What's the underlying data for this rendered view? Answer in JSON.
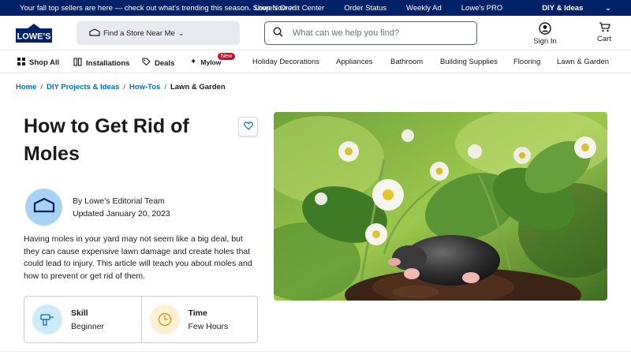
{
  "promo_bar": {
    "promo_text": "Your fall top sellers are here — check out what's trending this season. Shop Now >",
    "links": [
      "Lowe's Credit Center",
      "Order Status",
      "Weekly Ad",
      "Lowe's PRO",
      "DIY & Ideas"
    ]
  },
  "header": {
    "logo_text": "LOWE'S",
    "store_label": "Find a Store Near Me",
    "search_placeholder": "What can we help you find?",
    "signin_label": "Sign In",
    "cart_label": "Cart"
  },
  "nav": {
    "items": [
      "Shop All",
      "Installations",
      "Deals",
      "Mylow",
      "Holiday Decorations",
      "Appliances",
      "Bathroom",
      "Building Supplies",
      "Flooring",
      "Lawn & Garden"
    ],
    "new_badge": "New"
  },
  "breadcrumb": {
    "items": [
      "Home",
      "DIY Projects & Ideas",
      "How-Tos"
    ],
    "current": "Lawn & Garden",
    "separator": "/"
  },
  "article": {
    "title": "How to Get Rid of Moles",
    "author": "By Lowe's Editorial Team",
    "updated": "Updated January 20, 2023",
    "intro": "Having moles in your yard may not seem like a big deal, but they can cause expensive lawn damage and create holes that could lead to injury. This article will teach you about moles and how to prevent or get rid of them.",
    "skill_label": "Skill",
    "skill_value": "Beginner",
    "time_label": "Time",
    "time_value": "Few Hours"
  },
  "colors": {
    "brand_navy": "#012169",
    "link_blue": "#0471af",
    "avatar_bg": "#a8d3f2",
    "skill_icon_bg": "#cfeaf9",
    "time_icon_bg": "#fdf0d5"
  },
  "icons": [
    "store-icon",
    "chevron-down-icon",
    "search-icon",
    "user-icon",
    "cart-icon",
    "grid-icon",
    "installations-icon",
    "tag-icon",
    "sparkle-icon",
    "heart-icon",
    "drill-icon",
    "clock-icon"
  ]
}
